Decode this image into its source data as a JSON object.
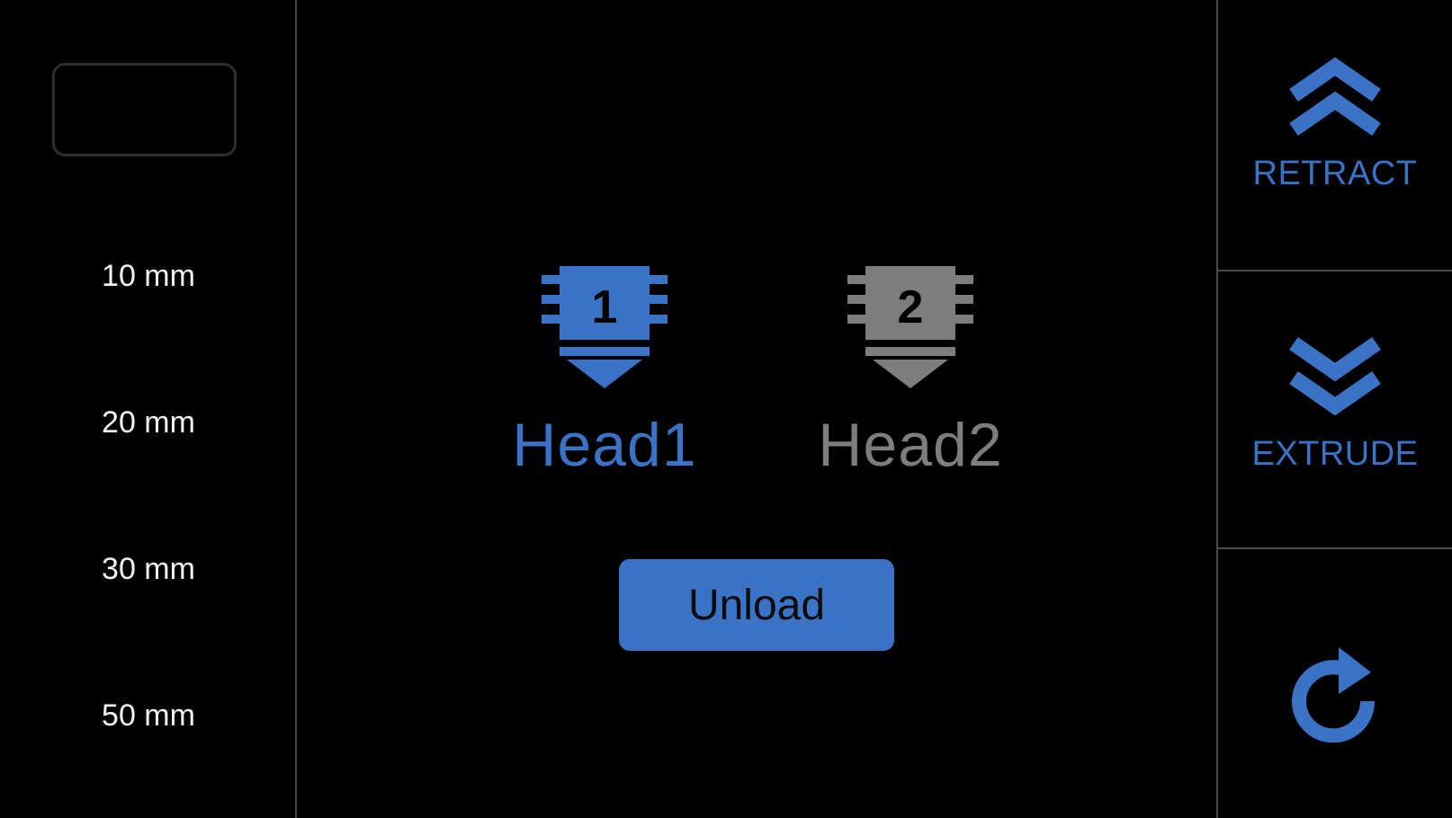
{
  "colors": {
    "accent": "#3a73c6",
    "inactive": "#7d7d7d",
    "background": "#000000",
    "divider": "#4a4a4a"
  },
  "distances": [
    "10 mm",
    "20 mm",
    "30 mm",
    "50 mm"
  ],
  "heads": [
    {
      "number": "1",
      "label": "Head1",
      "state": "selected",
      "icon": "nozzle-head-1-icon"
    },
    {
      "number": "2",
      "label": "Head2",
      "state": "unselected",
      "icon": "nozzle-head-2-icon"
    }
  ],
  "actions": {
    "unload_label": "Unload",
    "retract_label": "RETRACT",
    "extrude_label": "EXTRUDE",
    "retract_icon": "double-chevron-up-icon",
    "extrude_icon": "double-chevron-down-icon",
    "refresh_icon": "refresh-icon"
  }
}
